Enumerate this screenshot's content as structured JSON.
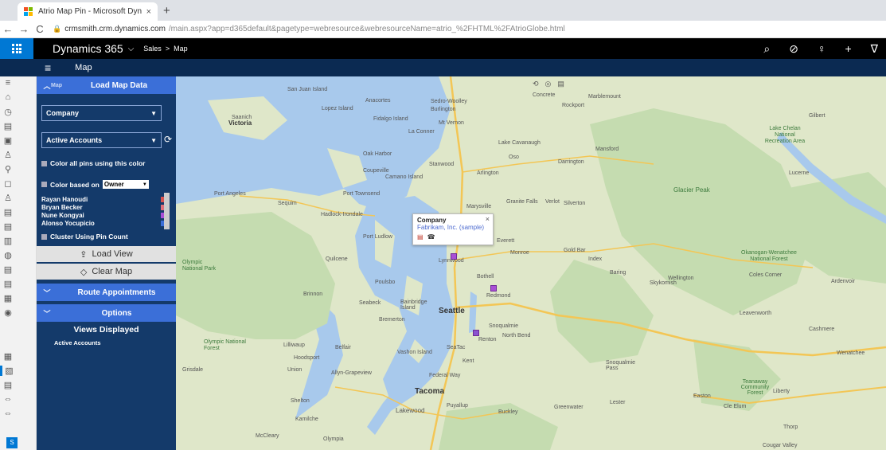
{
  "browser": {
    "tab_title": "Atrio Map Pin - Microsoft Dynan",
    "tab_close": "×",
    "new_tab": "+",
    "url_host": "crmsmith.crm.dynamics.com",
    "url_rest": "/main.aspx?app=d365default&pagetype=webresource&webresourceName=atrio_%2FHTML%2FAtrioGlobe.html",
    "back": "←",
    "forward": "→",
    "reload": "C"
  },
  "appbar": {
    "brand": "Dynamics 365",
    "brand_caret": "⌵",
    "crumb_area": "Sales",
    "crumb_sep": ">",
    "crumb_page": "Map",
    "actions": [
      "⌕",
      "⊘",
      "♀",
      "+",
      "∇"
    ]
  },
  "subbar": {
    "menu": "≡",
    "title": "Map"
  },
  "panel": {
    "load_map_data": "Load Map Data",
    "load_map_prefix": "Map",
    "entity_select": "Company",
    "view_select": "Active Accounts",
    "color_all_label": "Color all pins using this color",
    "color_based_label": "Color based on",
    "color_based_select": "Owner",
    "owners": [
      {
        "name": "Rayan Hanoudi",
        "color": "#d9534f"
      },
      {
        "name": "Bryan Becker",
        "color": "#e0707a"
      },
      {
        "name": "Nune Kongyai",
        "color": "#a94fd6"
      },
      {
        "name": "Alonso Yocupicio",
        "color": "#3b6fd8"
      }
    ],
    "cluster_label": "Cluster Using Pin Count",
    "load_view": "Load View",
    "clear_map": "Clear Map",
    "route_appointments": "Route Appointments",
    "options": "Options",
    "views_displayed": "Views Displayed",
    "views_item": "Active Accounts"
  },
  "map": {
    "labels": [
      {
        "text": "San Juan Island",
        "kind": "town"
      },
      {
        "text": "Anacortes",
        "kind": "town"
      },
      {
        "text": "Sedro-Woolley",
        "kind": "town"
      },
      {
        "text": "Burlington",
        "kind": "town"
      },
      {
        "text": "Concrete",
        "kind": "town"
      },
      {
        "text": "Marblemount",
        "kind": "town"
      },
      {
        "text": "Rockport",
        "kind": "town"
      },
      {
        "text": "Saanich",
        "kind": "town"
      },
      {
        "text": "Victoria",
        "kind": "town"
      },
      {
        "text": "Lopez Island",
        "kind": "town"
      },
      {
        "text": "Fidalgo Island",
        "kind": "town"
      },
      {
        "text": "Mt Vernon",
        "kind": "town"
      },
      {
        "text": "La Conner",
        "kind": "town"
      },
      {
        "text": "Oak Harbor",
        "kind": "town"
      },
      {
        "text": "Lake Cavanaugh",
        "kind": "town"
      },
      {
        "text": "Oso",
        "kind": "town"
      },
      {
        "text": "Stanwood",
        "kind": "town"
      },
      {
        "text": "Coupeville",
        "kind": "town"
      },
      {
        "text": "Camano Island",
        "kind": "town"
      },
      {
        "text": "Arlington",
        "kind": "town"
      },
      {
        "text": "Darrington",
        "kind": "town"
      },
      {
        "text": "Mansford",
        "kind": "town"
      },
      {
        "text": "Lake Chelan National Recreation Area",
        "kind": "park"
      },
      {
        "text": "Port Angeles",
        "kind": "town"
      },
      {
        "text": "Sequim",
        "kind": "town"
      },
      {
        "text": "Port Townsend",
        "kind": "town"
      },
      {
        "text": "Granite Falls",
        "kind": "town"
      },
      {
        "text": "Verlot",
        "kind": "town"
      },
      {
        "text": "Silverton",
        "kind": "town"
      },
      {
        "text": "Glacier Peak",
        "kind": "park"
      },
      {
        "text": "Marysville",
        "kind": "town"
      },
      {
        "text": "Hadlock-Irondale",
        "kind": "town"
      },
      {
        "text": "Port Ludlow",
        "kind": "town"
      },
      {
        "text": "Everett",
        "kind": "town"
      },
      {
        "text": "Gold Bar",
        "kind": "town"
      },
      {
        "text": "Index",
        "kind": "town"
      },
      {
        "text": "Monroe",
        "kind": "town"
      },
      {
        "text": "Olympic National Park",
        "kind": "park"
      },
      {
        "text": "Quilcene",
        "kind": "town"
      },
      {
        "text": "Lynnwood",
        "kind": "town"
      },
      {
        "text": "Bothell",
        "kind": "town"
      },
      {
        "text": "Baring",
        "kind": "town"
      },
      {
        "text": "Skykomish",
        "kind": "town"
      },
      {
        "text": "Poulsbo",
        "kind": "town"
      },
      {
        "text": "Redmond",
        "kind": "town"
      },
      {
        "text": "Brinnon",
        "kind": "town"
      },
      {
        "text": "Seabeck",
        "kind": "town"
      },
      {
        "text": "Bainbridge Island",
        "kind": "town"
      },
      {
        "text": "Seattle",
        "kind": "city"
      },
      {
        "text": "Bremerton",
        "kind": "town"
      },
      {
        "text": "Snoqualmie",
        "kind": "town"
      },
      {
        "text": "North Bend",
        "kind": "town"
      },
      {
        "text": "Renton",
        "kind": "town"
      },
      {
        "text": "Olympic National Forest",
        "kind": "park"
      },
      {
        "text": "Lilliwaup",
        "kind": "town"
      },
      {
        "text": "Belfair",
        "kind": "town"
      },
      {
        "text": "Vashon Island",
        "kind": "town"
      },
      {
        "text": "SeaTac",
        "kind": "town"
      },
      {
        "text": "Hoodsport",
        "kind": "town"
      },
      {
        "text": "Kent",
        "kind": "town"
      },
      {
        "text": "Grisdale",
        "kind": "town"
      },
      {
        "text": "Union",
        "kind": "town"
      },
      {
        "text": "Allyn-Grapeview",
        "kind": "town"
      },
      {
        "text": "Federal Way",
        "kind": "town"
      },
      {
        "text": "Tacoma",
        "kind": "city"
      },
      {
        "text": "Shelton",
        "kind": "town"
      },
      {
        "text": "Puyallup",
        "kind": "town"
      },
      {
        "text": "Lakewood",
        "kind": "town"
      },
      {
        "text": "Buckley",
        "kind": "town"
      },
      {
        "text": "Greenwater",
        "kind": "town"
      },
      {
        "text": "Kamilche",
        "kind": "town"
      },
      {
        "text": "McCleary",
        "kind": "town"
      },
      {
        "text": "Olympia",
        "kind": "town"
      },
      {
        "text": "Okanogan-Wenatchee National Forest",
        "kind": "park"
      },
      {
        "text": "Coles Corner",
        "kind": "town"
      },
      {
        "text": "Wellington",
        "kind": "town"
      },
      {
        "text": "Ardenvoir",
        "kind": "town"
      },
      {
        "text": "Leavenworth",
        "kind": "town"
      },
      {
        "text": "Cashmere",
        "kind": "town"
      },
      {
        "text": "Wenatchee",
        "kind": "town"
      },
      {
        "text": "Gilbert",
        "kind": "town"
      },
      {
        "text": "Lucerne",
        "kind": "town"
      },
      {
        "text": "Easton",
        "kind": "town"
      },
      {
        "text": "Liberty",
        "kind": "town"
      },
      {
        "text": "Cle Elum",
        "kind": "town"
      },
      {
        "text": "Teanaway Community Forest",
        "kind": "park"
      },
      {
        "text": "Thorp",
        "kind": "town"
      },
      {
        "text": "Cougar Valley",
        "kind": "town"
      },
      {
        "text": "Snoqualmie Pass",
        "kind": "town"
      },
      {
        "text": "Lester",
        "kind": "town"
      }
    ],
    "tools": [
      "⟲",
      "◎",
      "▤"
    ],
    "popup": {
      "title": "Company",
      "link": "Fabrikam, Inc. (sample)",
      "close": "×",
      "icons": [
        "▤",
        "☎"
      ]
    }
  },
  "rail": {
    "avatar": "S"
  }
}
